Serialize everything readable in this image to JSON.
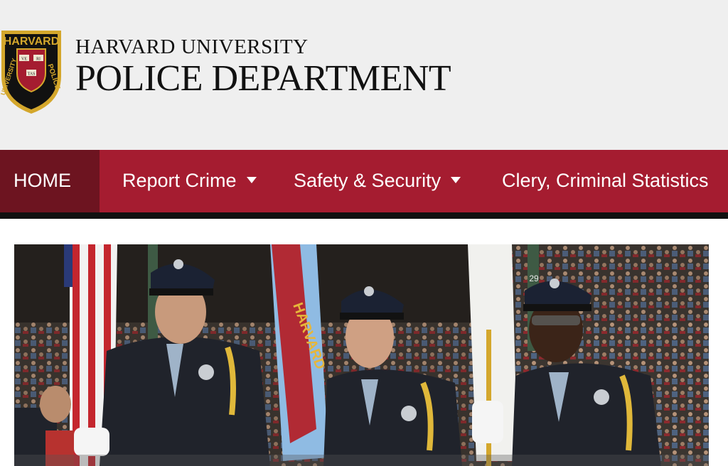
{
  "header": {
    "logo": {
      "top_text": "HARVARD",
      "left_text": "UNIVERSITY",
      "right_text": "POLICE",
      "shield_words": [
        "VE",
        "RI",
        "TAS"
      ]
    },
    "title_line1": "HARVARD UNIVERSITY",
    "title_line2": "POLICE DEPARTMENT"
  },
  "nav": {
    "items": [
      {
        "label": "HOME",
        "active": true,
        "has_dropdown": false
      },
      {
        "label": "Report Crime",
        "active": false,
        "has_dropdown": true
      },
      {
        "label": "Safety & Security",
        "active": false,
        "has_dropdown": true
      },
      {
        "label": "Clery, Criminal Statistics",
        "active": false,
        "has_dropdown": false
      }
    ]
  },
  "hero": {
    "flag_text": "HARVARD",
    "pillar_number": "29"
  },
  "colors": {
    "crimson": "#a51c30",
    "active_nav": "#6d1420",
    "header_bg": "#efefef",
    "logo_gold": "#d4a72c"
  }
}
